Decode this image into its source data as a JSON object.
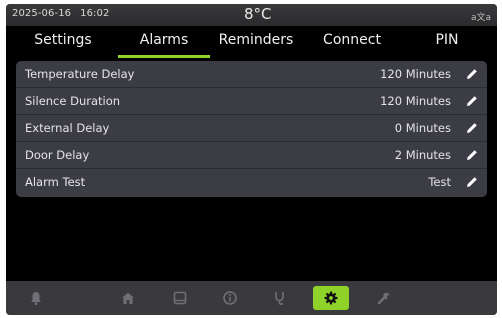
{
  "status": {
    "date": "2025-06-16",
    "time": "16:02",
    "temperature": "8°C",
    "language_icon": "language-icon"
  },
  "tabs": [
    {
      "label": "Settings",
      "active": false
    },
    {
      "label": "Alarms",
      "active": true
    },
    {
      "label": "Reminders",
      "active": false
    },
    {
      "label": "Connect",
      "active": false
    },
    {
      "label": "PIN",
      "active": false
    }
  ],
  "alarm_settings": [
    {
      "label": "Temperature Delay",
      "value": "120 Minutes"
    },
    {
      "label": "Silence Duration",
      "value": "120 Minutes"
    },
    {
      "label": "External Delay",
      "value": "0 Minutes"
    },
    {
      "label": "Door Delay",
      "value": "2 Minutes"
    },
    {
      "label": "Alarm Test",
      "value": "Test"
    }
  ],
  "bottom_nav": [
    {
      "icon": "bell-icon",
      "active": false
    },
    {
      "icon": "home-icon",
      "active": false
    },
    {
      "icon": "log-icon",
      "active": false
    },
    {
      "icon": "info-icon",
      "active": false
    },
    {
      "icon": "stethoscope-icon",
      "active": false
    },
    {
      "icon": "gear-icon",
      "active": true
    },
    {
      "icon": "wrench-icon",
      "active": false
    }
  ],
  "colors": {
    "accent": "#8fd22a",
    "card": "#3c3c45",
    "background": "#000000"
  }
}
